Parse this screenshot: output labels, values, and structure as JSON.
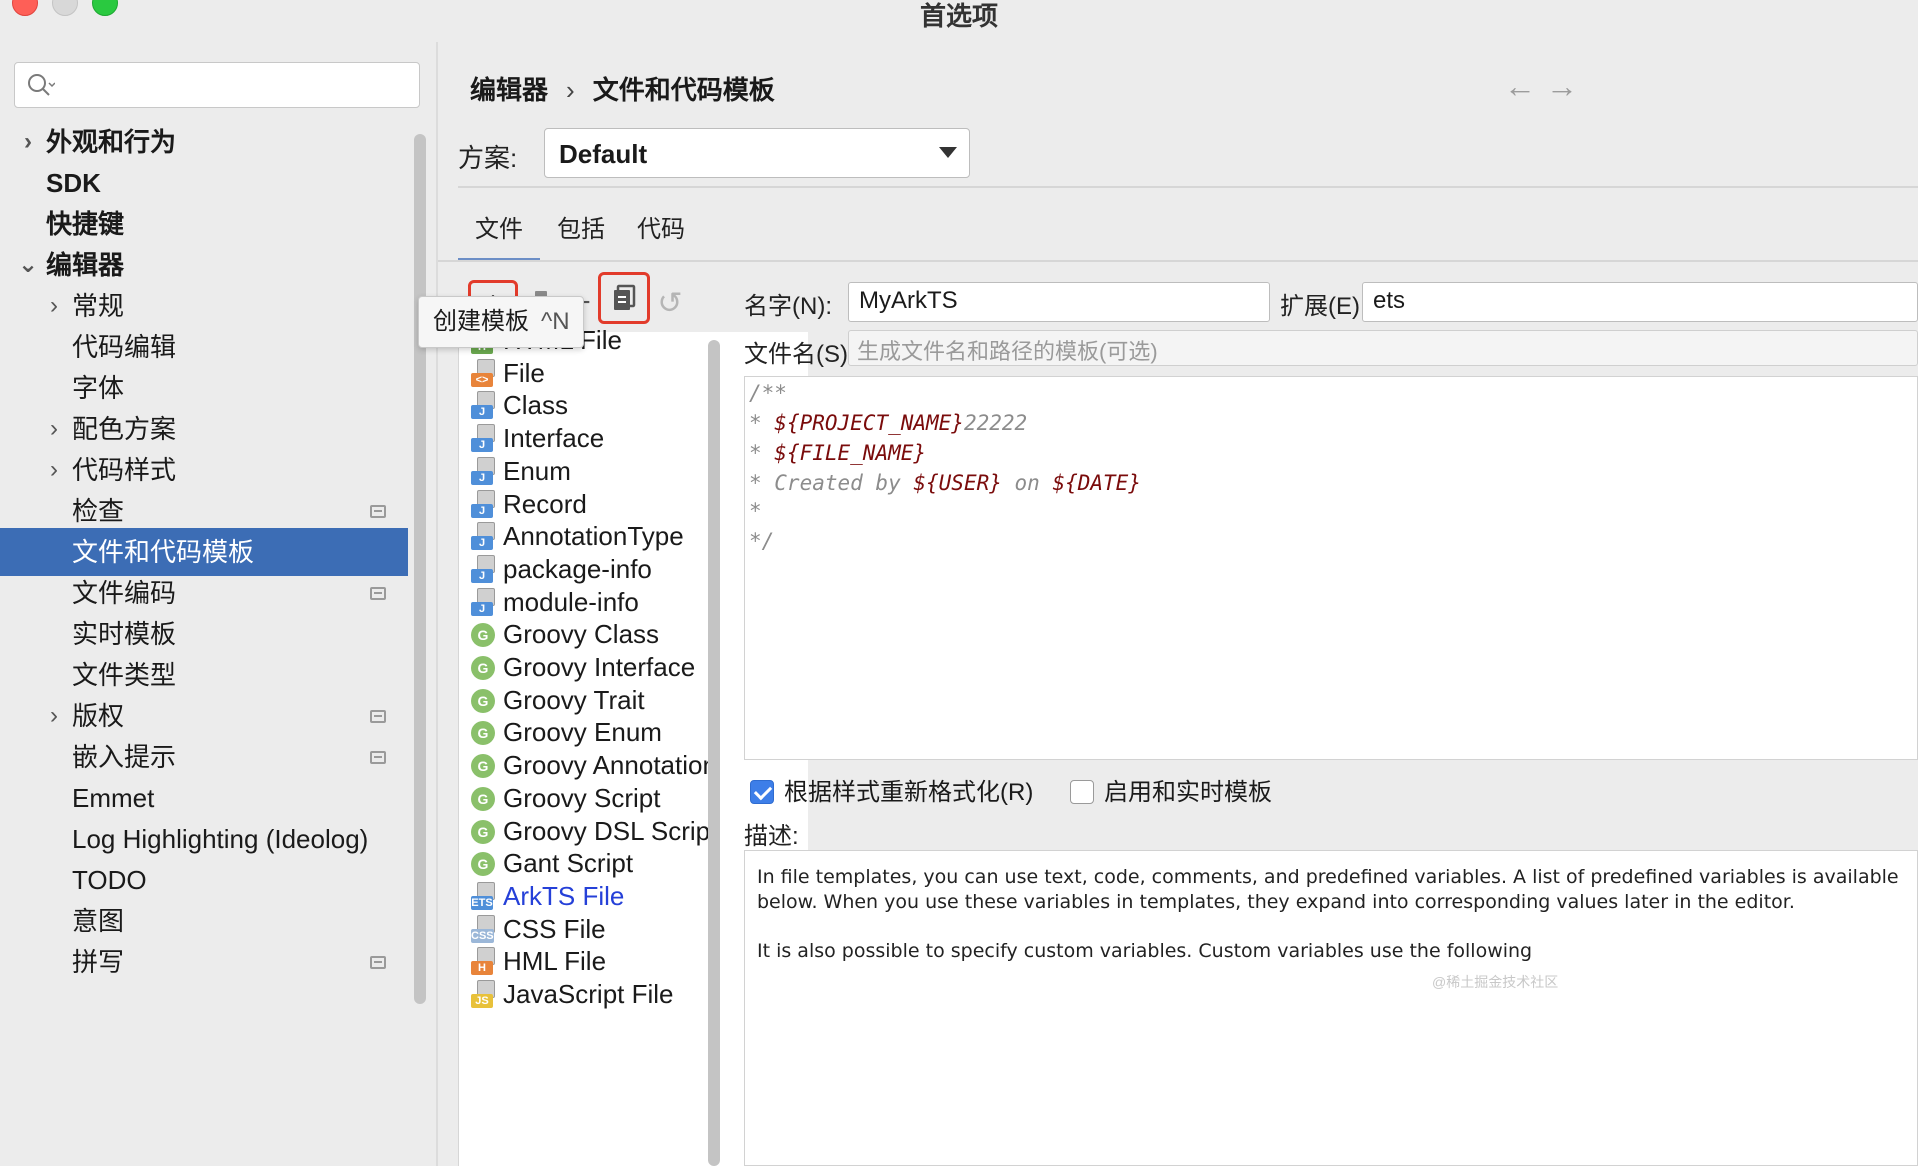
{
  "window": {
    "title": "首选项"
  },
  "search": {
    "placeholder": ""
  },
  "sidebar": {
    "items": [
      {
        "label": "外观和行为",
        "arrow": "›",
        "bold": true
      },
      {
        "label": "SDK",
        "bold": true
      },
      {
        "label": "快捷键",
        "bold": true
      },
      {
        "label": "编辑器",
        "arrow": "⌄",
        "bold": true
      },
      {
        "label": "常规",
        "arrow": "›"
      },
      {
        "label": "代码编辑"
      },
      {
        "label": "字体"
      },
      {
        "label": "配色方案",
        "arrow": "›"
      },
      {
        "label": "代码样式",
        "arrow": "›"
      },
      {
        "label": "检查",
        "side_icon": true
      },
      {
        "label": "文件和代码模板",
        "selected": true
      },
      {
        "label": "文件编码",
        "side_icon": true
      },
      {
        "label": "实时模板"
      },
      {
        "label": "文件类型"
      },
      {
        "label": "版权",
        "arrow": "›",
        "side_icon": true
      },
      {
        "label": "嵌入提示",
        "side_icon": true
      },
      {
        "label": "Emmet"
      },
      {
        "label": "Log Highlighting (Ideolog)"
      },
      {
        "label": "TODO"
      },
      {
        "label": "意图"
      },
      {
        "label": "拼写",
        "side_icon": true
      }
    ]
  },
  "breadcrumb": {
    "parent": "编辑器",
    "separator": "›",
    "current": "文件和代码模板"
  },
  "nav": {
    "back": "←",
    "forward": "→"
  },
  "scheme": {
    "label": "方案:",
    "value": "Default"
  },
  "tabs": [
    {
      "label": "文件",
      "active": true
    },
    {
      "label": "包括"
    },
    {
      "label": "代码"
    }
  ],
  "toolbar": {
    "add": "+",
    "add_child": "add-child-icon",
    "remove": "−",
    "copy": "copy-icon",
    "reset": "↺",
    "highlight_color": "#e23b2b"
  },
  "tooltip": {
    "text": "创建模板",
    "shortcut": "^N"
  },
  "templates": [
    {
      "label": "HTML File",
      "icon": "H",
      "color": "#6aa84f"
    },
    {
      "label": "File",
      "icon": "<>",
      "color": "#e8843a"
    },
    {
      "label": "Class",
      "icon": "J",
      "color": "#4f8fd9"
    },
    {
      "label": "Interface",
      "icon": "J",
      "color": "#4f8fd9"
    },
    {
      "label": "Enum",
      "icon": "J",
      "color": "#4f8fd9"
    },
    {
      "label": "Record",
      "icon": "J",
      "color": "#4f8fd9"
    },
    {
      "label": "AnnotationType",
      "icon": "J",
      "color": "#4f8fd9"
    },
    {
      "label": "package-info",
      "icon": "J",
      "color": "#4f8fd9"
    },
    {
      "label": "module-info",
      "icon": "J",
      "color": "#4f8fd9"
    },
    {
      "label": "Groovy Class",
      "groovy": true
    },
    {
      "label": "Groovy Interface",
      "groovy": true
    },
    {
      "label": "Groovy Trait",
      "groovy": true
    },
    {
      "label": "Groovy Enum",
      "groovy": true
    },
    {
      "label": "Groovy Annotation",
      "groovy": true
    },
    {
      "label": "Groovy Script",
      "groovy": true
    },
    {
      "label": "Groovy DSL Script",
      "groovy": true
    },
    {
      "label": "Gant Script",
      "groovy": true
    },
    {
      "label": "ArkTS File",
      "icon": "ETS",
      "color": "#4f8fd9",
      "blue": true
    },
    {
      "label": "CSS File",
      "icon": "CSS",
      "color": "#9bb7d8"
    },
    {
      "label": "HML File",
      "icon": "H",
      "color": "#e8843a"
    },
    {
      "label": "JavaScript File",
      "icon": "JS",
      "color": "#e8c13a"
    }
  ],
  "form": {
    "name_label": "名字(N):",
    "name_value": "MyArkTS",
    "ext_label": "扩展(E):",
    "ext_value": "ets",
    "filename_label": "文件名(S):",
    "filename_placeholder": "生成文件名和路径的模板(可选)"
  },
  "code": {
    "line1": "/**",
    "line2_prefix": "* ",
    "line2_var": "${PROJECT_NAME}",
    "line2_suffix": "22222",
    "line3_prefix": "* ",
    "line3_var": "${FILE_NAME}",
    "line4_prefix": "* Created by ",
    "line4_var1": "${USER}",
    "line4_mid": " on ",
    "line4_var2": "${DATE}",
    "line5": "*",
    "line6": "*/"
  },
  "checks": {
    "reformat_label": "根据样式重新格式化(R)",
    "reformat_checked": true,
    "live_label": "启用和实时模板",
    "live_checked": false
  },
  "description": {
    "label": "描述:",
    "p1": "In file templates, you can use text, code, comments, and predefined variables. A list of predefined variables is available below. When you use these variables in templates, they expand into corresponding values later in the editor.",
    "p2": "It is also possible to specify custom variables. Custom variables use the following"
  },
  "watermark": "@稀土掘金技术社区"
}
